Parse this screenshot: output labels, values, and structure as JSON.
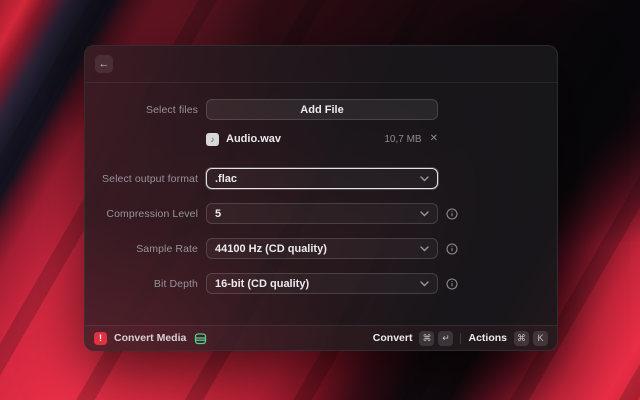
{
  "colors": {
    "accent": "#dd3340",
    "success_green": "#4fd08c",
    "focus_border": "#e4e2e6",
    "wallpaper_red": "#ef3049"
  },
  "header": {
    "back_icon": "←"
  },
  "form": {
    "select_files": {
      "label": "Select files",
      "add_button": "Add File"
    },
    "file": {
      "icon_glyph": "♪",
      "name": "Audio.wav",
      "size": "10,7 MB",
      "remove_glyph": "✕"
    },
    "fields": [
      {
        "label": "Select output format",
        "value": ".flac",
        "focused": true,
        "has_info": false
      },
      {
        "label": "Compression Level",
        "value": "5",
        "focused": false,
        "has_info": true
      },
      {
        "label": "Sample Rate",
        "value": "44100 Hz (CD quality)",
        "focused": false,
        "has_info": true
      },
      {
        "label": "Bit Depth",
        "value": "16-bit (CD quality)",
        "focused": false,
        "has_info": true
      }
    ]
  },
  "footer": {
    "app_name": "Convert Media",
    "app_icon_glyph": "!",
    "actions": [
      {
        "label": "Convert",
        "keys": [
          "⌘",
          "↵"
        ]
      },
      {
        "label": "Actions",
        "keys": [
          "⌘",
          "K"
        ]
      }
    ]
  }
}
